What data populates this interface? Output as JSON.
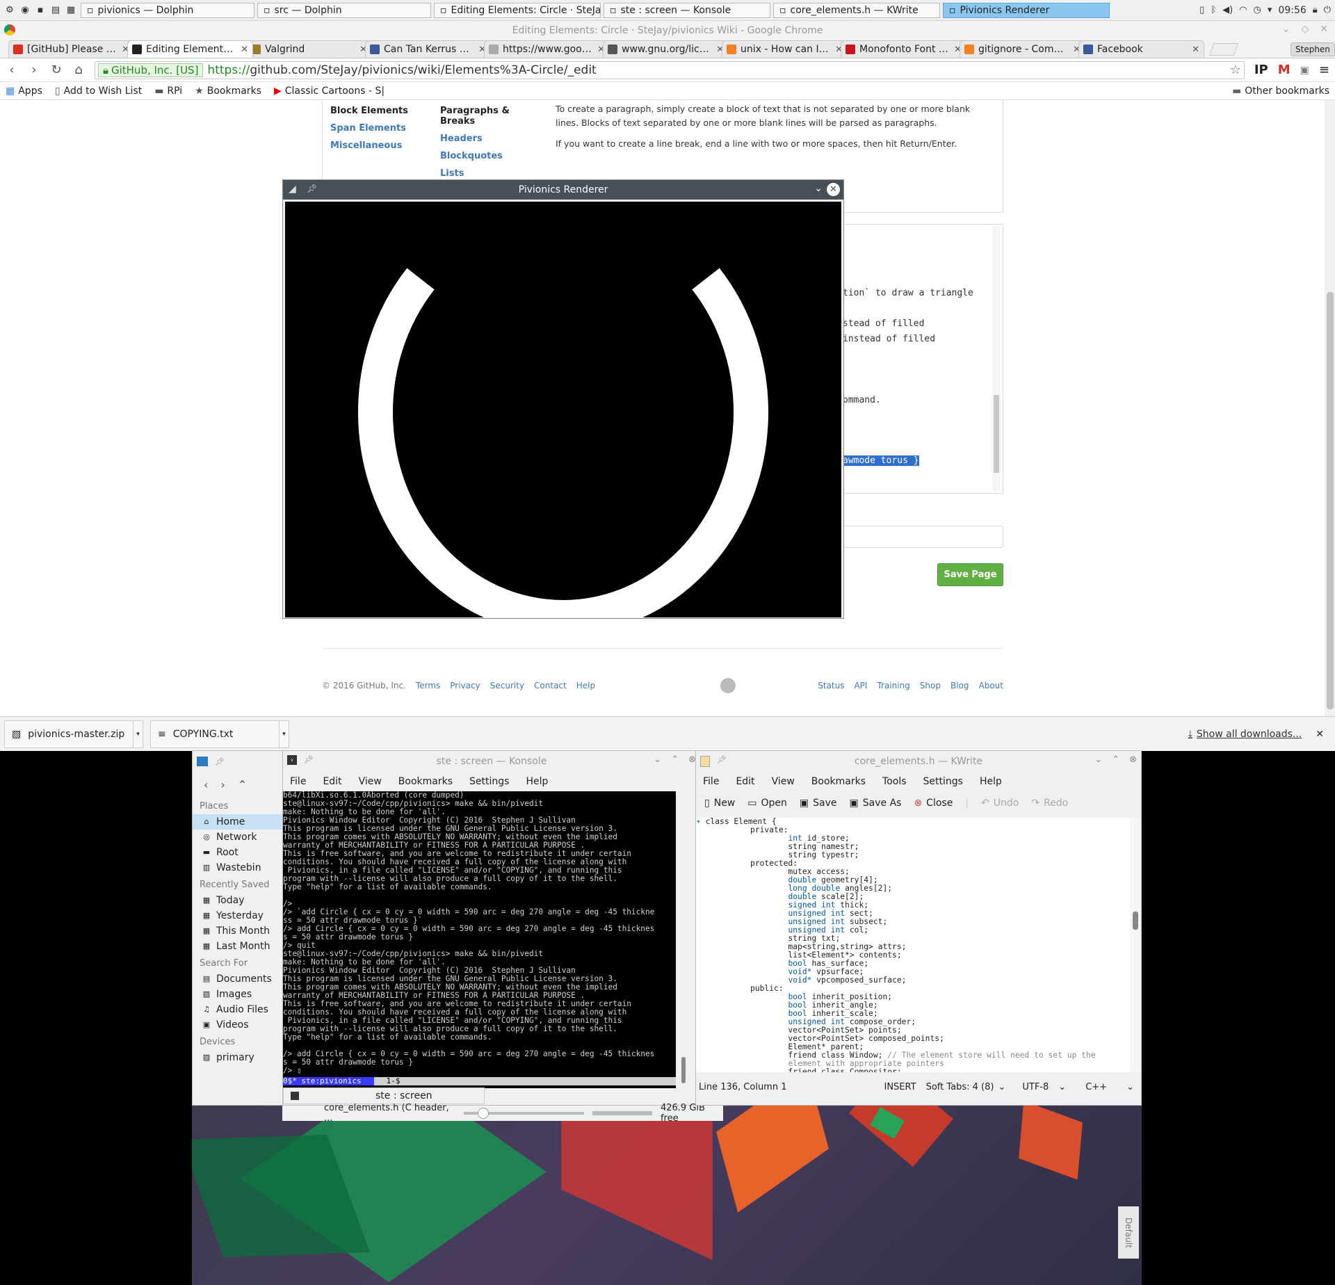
{
  "taskbar": {
    "tasks": [
      {
        "label": "pivionics — Dolphin",
        "active": false
      },
      {
        "label": "src — Dolphin",
        "active": false
      },
      {
        "label": "Editing Elements: Circle · SteJay/piv",
        "active": false
      },
      {
        "label": "ste : screen — Konsole",
        "active": false
      },
      {
        "label": "core_elements.h  — KWrite",
        "active": false
      },
      {
        "label": "Pivionics Renderer",
        "active": true
      }
    ],
    "clock": "09:56"
  },
  "chrome": {
    "window_title": "Editing Elements: Circle · SteJay/pivionics Wiki - Google Chrome",
    "profile": "Stephen",
    "tabs": [
      {
        "label": "[GitHub] Please verify",
        "favicon_color": "#d93025",
        "active": false
      },
      {
        "label": "Editing Elements: Circ",
        "favicon_color": "#222222",
        "active": true
      },
      {
        "label": "Valgrind",
        "favicon_color": "#9c7c2c",
        "active": false
      },
      {
        "label": "Can Tan Kerrus Hunt",
        "favicon_color": "#3b5998",
        "active": false
      },
      {
        "label": "https://www.google.c",
        "favicon_color": "#aaaaaa",
        "active": false
      },
      {
        "label": "www.gnu.org/license",
        "favicon_color": "#555555",
        "active": false
      },
      {
        "label": "unix - How can I repla",
        "favicon_color": "#f48024",
        "active": false
      },
      {
        "label": "Monofonto Font | da",
        "favicon_color": "#c4161c",
        "active": false
      },
      {
        "label": "gitignore - Commit e",
        "favicon_color": "#f48024",
        "active": false
      },
      {
        "label": "Facebook",
        "favicon_color": "#3b5998",
        "active": false
      }
    ],
    "secure_label": "GitHub, Inc. [US]",
    "url_scheme": "https://",
    "url_rest": "github.com/SteJay/pivionics/wiki/Elements%3A-Circle/_edit",
    "bookmarks": [
      "Apps",
      "Add to Wish List",
      "RPi",
      "Bookmarks",
      "Classic Cartoons - S|"
    ],
    "other_bookmarks": "Other bookmarks"
  },
  "page": {
    "md_col1_head": "Block Elements",
    "md_col1": [
      "Span Elements",
      "Miscellaneous"
    ],
    "md_col2_head": "Paragraphs & Breaks",
    "md_col2": [
      "Headers",
      "Blockquotes",
      "Lists",
      "Code Blocks"
    ],
    "md_para1": "To create a paragraph, simply create a block of text that is not separated by one or more blank lines. Blocks of text separated by one or more blank lines will be parsed as paragraphs.",
    "md_para2": "If you want to create a line break, end a line with two or more spaces, then hit Return/Enter.",
    "editor_frags": [
      "tion` to draw a triangle",
      "stead of filled",
      " instead of filled",
      "ommand.",
      "awmode torus }"
    ],
    "save_button": "Save Page",
    "footer_copy": "© 2016 GitHub, Inc.",
    "footer_left": [
      "Terms",
      "Privacy",
      "Security",
      "Contact",
      "Help"
    ],
    "footer_right": [
      "Status",
      "API",
      "Training",
      "Shop",
      "Blog",
      "About"
    ]
  },
  "renderer": {
    "title": "Pivionics Renderer"
  },
  "downloads": {
    "items": [
      "pivionics-master.zip",
      "COPYING.txt"
    ],
    "show_all": "Show all downloads..."
  },
  "dolphin": {
    "places_head": "Places",
    "places": [
      "Home",
      "Network",
      "Root",
      "Wastebin"
    ],
    "recent_head": "Recently Saved",
    "recent": [
      "Today",
      "Yesterday",
      "This Month",
      "Last Month"
    ],
    "search_head": "Search For",
    "search": [
      "Documents",
      "Images",
      "Audio Files",
      "Videos"
    ],
    "devices_head": "Devices",
    "devices": [
      "primary"
    ],
    "status_file": "core_elements.h (C header, ...",
    "free_space": "426.9 GiB free"
  },
  "konsole": {
    "title": "ste : screen — Konsole",
    "menu": [
      "File",
      "Edit",
      "View",
      "Bookmarks",
      "Settings",
      "Help"
    ],
    "lines": [
      "b64/libXi.so.6.1.0Aborted (core dumped)",
      "ste@linux-sv97:~/Code/cpp/pivionics> make && bin/pivedit",
      "make: Nothing to be done for 'all'.",
      "Pivionics Window Editor  Copyright (C) 2016  Stephen J Sullivan",
      "This program is licensed under the GNU General Public License version 3.",
      "This program comes with ABSOLUTELY NO WARRANTY; without even the implied",
      "warranty of MERCHANTABILITY or FITNESS FOR A PARTICULAR PURPOSE .",
      "This is free software, and you are welcome to redistribute it under certain",
      "conditions. You should have received a full copy of the license along with",
      " Pivionics, in a file called \"LICENSE\" and/or \"COPYING\", and running this",
      "program with --license will also produce a full copy of it to the shell.",
      "Type \"help\" for a list of available commands.",
      "",
      "/>",
      "/> `add Circle { cx = 0 cy = 0 width = 590 arc = deg 270 angle = deg -45 thickne",
      "ss = 50 attr drawmode torus }`",
      "/> add Circle { cx = 0 cy = 0 width = 590 arc = deg 270 angle = deg -45 thicknes",
      "s = 50 attr drawmode torus }",
      "/> quit",
      "ste@linux-sv97:~/Code/cpp/pivionics> make && bin/pivedit",
      "make: Nothing to be done for 'all'.",
      "Pivionics Window Editor  Copyright (C) 2016  Stephen J Sullivan",
      "This program is licensed under the GNU General Public License version 3.",
      "This program comes with ABSOLUTELY NO WARRANTY; without even the implied",
      "warranty of MERCHANTABILITY or FITNESS FOR A PARTICULAR PURPOSE .",
      "This is free software, and you are welcome to redistribute it under certain",
      "conditions. You should have received a full copy of the license along with",
      " Pivionics, in a file called \"LICENSE\" and/or \"COPYING\", and running this",
      "program with --license will also produce a full copy of it to the shell.",
      "Type \"help\" for a list of available commands.",
      "",
      "/> add Circle { cx = 0 cy = 0 width = 590 arc = deg 270 angle = deg -45 thicknes",
      "s = 50 attr drawmode torus }",
      "/> ▯"
    ],
    "status_bar_left": "0$* ste:pivionics",
    "status_bar_right": "1-$",
    "tab_label": "ste : screen"
  },
  "kwrite": {
    "title": "core_elements.h  — KWrite",
    "menu": [
      "File",
      "Edit",
      "View",
      "Bookmarks",
      "Tools",
      "Settings",
      "Help"
    ],
    "tools": [
      {
        "label": "New",
        "icon": "new-document-icon",
        "enabled": true
      },
      {
        "label": "Open",
        "icon": "folder-open-icon",
        "enabled": true
      },
      {
        "label": "Save",
        "icon": "save-icon",
        "enabled": true
      },
      {
        "label": "Save As",
        "icon": "save-as-icon",
        "enabled": true
      },
      {
        "label": "Close",
        "icon": "close-document-icon",
        "enabled": true
      },
      {
        "label": "Undo",
        "icon": "undo-icon",
        "enabled": false
      },
      {
        "label": "Redo",
        "icon": "redo-icon",
        "enabled": false
      }
    ],
    "code": [
      [
        "",
        "class Element {"
      ],
      [
        "",
        "        private:"
      ],
      [
        "t",
        "int",
        " id_store;"
      ],
      [
        "",
        "                string namestr;"
      ],
      [
        "",
        "                string typestr;"
      ],
      [
        "",
        "        protected:"
      ],
      [
        "",
        "                mutex access;"
      ],
      [
        "t",
        "double",
        " geometry[4];"
      ],
      [
        "t",
        "long double",
        " angles[2];"
      ],
      [
        "t",
        "double",
        " scale[2];"
      ],
      [
        "t",
        "signed int",
        " thick;"
      ],
      [
        "t",
        "unsigned int",
        " sect;"
      ],
      [
        "t",
        "unsigned int",
        " subsect;"
      ],
      [
        "t",
        "unsigned int",
        " col;"
      ],
      [
        "",
        "                string txt;"
      ],
      [
        "",
        "                map<string,string> attrs;"
      ],
      [
        "",
        "                list<Element*> contents;"
      ],
      [
        "t",
        "bool",
        " has_surface;"
      ],
      [
        "t",
        "void*",
        " vpsurface;"
      ],
      [
        "t",
        "void*",
        " vpcomposed_surface;"
      ],
      [
        "",
        "        public:"
      ],
      [
        "t",
        "bool",
        " inherit_position;"
      ],
      [
        "t",
        "bool",
        " inherit_angle;"
      ],
      [
        "t",
        "bool",
        " inherit_scale;"
      ],
      [
        "t",
        "unsigned int",
        " compose_order;"
      ],
      [
        "",
        "                vector<PointSet> points;"
      ],
      [
        "",
        "                vector<PointSet> composed_points;"
      ],
      [
        "",
        "                Element* parent;"
      ],
      [
        "c",
        "                friend class Window; ",
        "// The element store will need to set up the"
      ],
      [
        "c",
        "                ",
        "element with appropriate pointers"
      ],
      [
        "",
        "                friend class Compositor;"
      ]
    ],
    "status": {
      "position": "Line 136, Column 1",
      "mode": "INSERT",
      "tabs": "Soft Tabs: 4 (8)",
      "encoding": "UTF-8",
      "language": "C++"
    }
  },
  "desktop": {
    "side_tab": "Default"
  }
}
